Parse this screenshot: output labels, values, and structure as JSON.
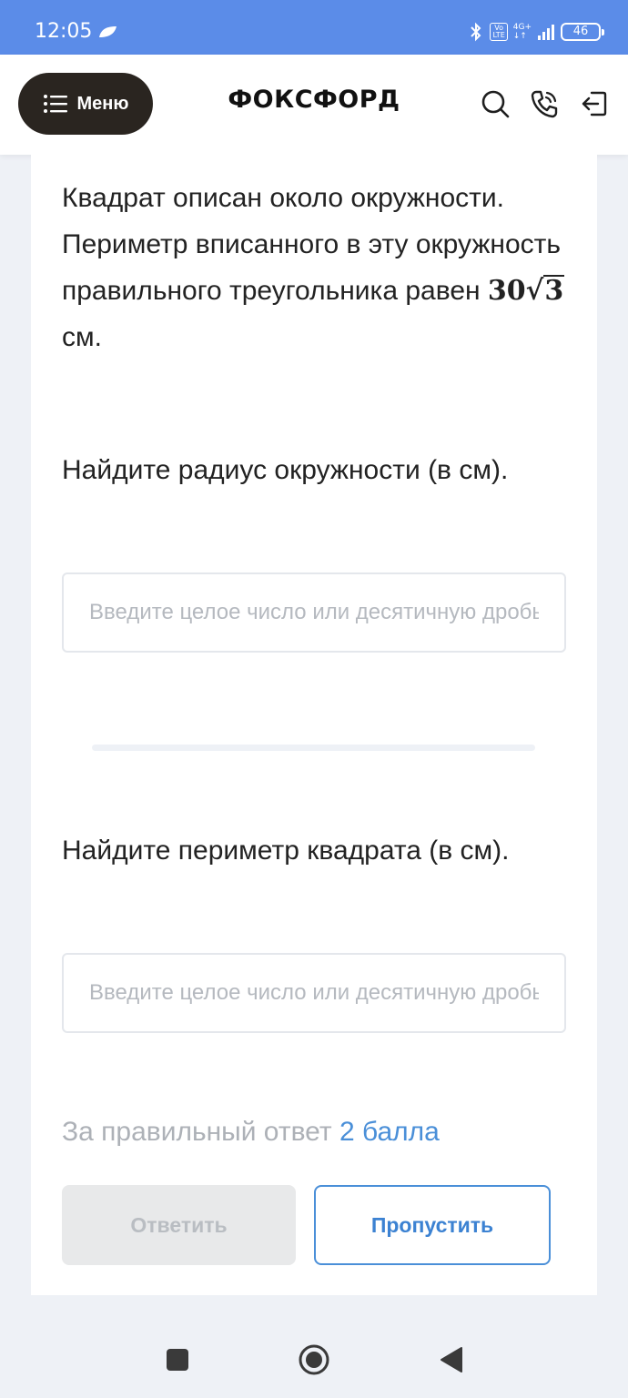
{
  "status_bar": {
    "time": "12:05",
    "volte": "Vo\nLTE",
    "network": "4G+",
    "battery": "46"
  },
  "header": {
    "menu_label": "Меню",
    "logo": "ФОКСФОРД"
  },
  "problem": {
    "text_before": "Квадрат описан около окружности. Периметр вписанного в эту окружность правильного треугольника равен ",
    "math_coefficient": "30",
    "math_radicand": "3",
    "text_after": " см."
  },
  "questions": [
    {
      "text": "Найдите радиус окружности (в см).",
      "placeholder": "Введите целое число или десятичную дробь"
    },
    {
      "text": "Найдите периметр квадрата (в см).",
      "placeholder": "Введите целое число или десятичную дробь"
    }
  ],
  "points": {
    "prefix": "За правильный ответ ",
    "value": "2 балла"
  },
  "buttons": {
    "answer": "Ответить",
    "skip": "Пропустить"
  },
  "colors": {
    "status_bar": "#5B8CE8",
    "menu_button": "#2A2520",
    "accent": "#4A8FD8",
    "page_bg": "#EEF1F6"
  },
  "icons": {
    "header": [
      "search-icon",
      "phone-icon",
      "login-icon"
    ],
    "nav": [
      "recents-icon",
      "home-icon",
      "back-icon"
    ]
  }
}
